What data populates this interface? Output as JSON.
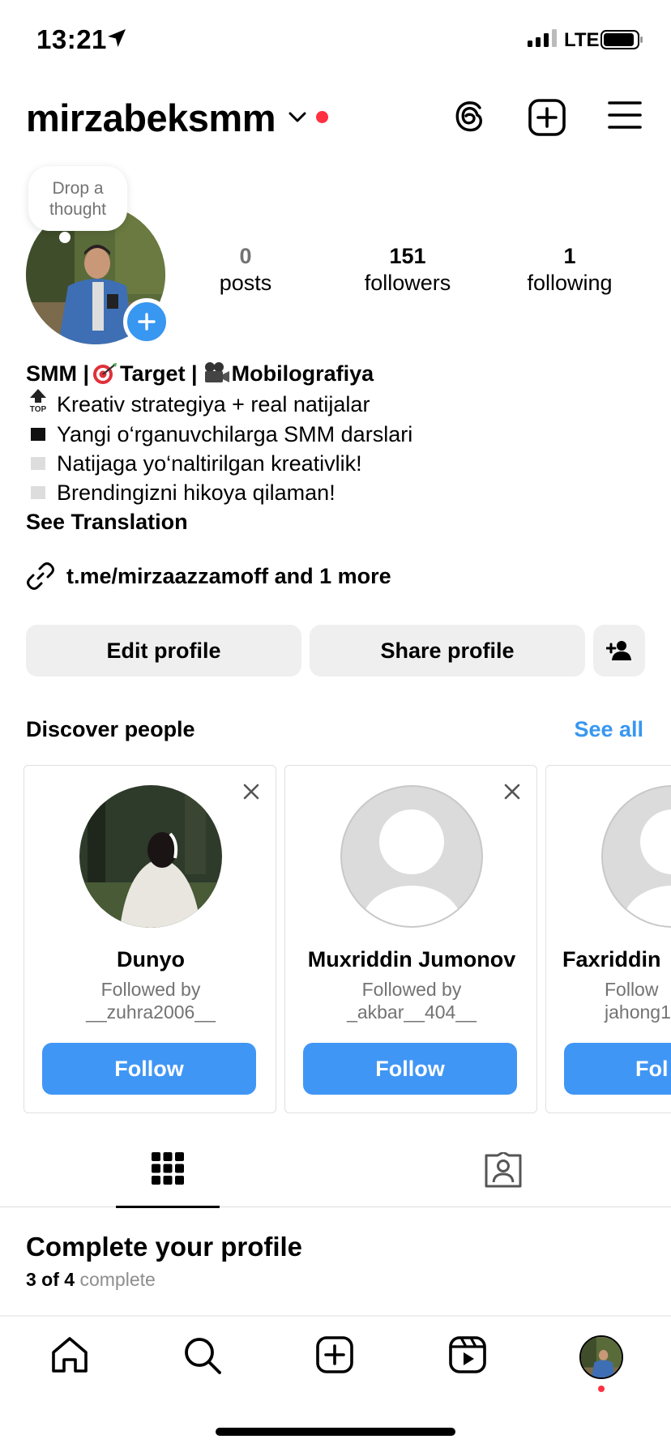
{
  "status_bar": {
    "time": "13:21",
    "network": "LTE"
  },
  "header": {
    "username": "mirzabeksmm",
    "icons": [
      "chevron-down-icon",
      "threads-icon",
      "create-post-icon",
      "menu-icon"
    ]
  },
  "note_bubble": {
    "line1": "Drop a",
    "line2": "thought"
  },
  "stats": {
    "posts": {
      "num": "0",
      "label": "posts"
    },
    "followers": {
      "num": "151",
      "label": "followers"
    },
    "following": {
      "num": "1",
      "label": "following"
    }
  },
  "bio": {
    "name_a": "SMM | ",
    "name_b": " Target | ",
    "name_c": " Mobilografiya",
    "line1": "Kreativ strategiya + real natijalar",
    "line2": "Yangi o‘rganuvchilarga SMM darslari",
    "line3": "Natijaga yo‘naltirilgan kreativlik!",
    "line4": "Brendingizni hikoya qilaman!",
    "see_translation": "See Translation",
    "top_badge": "TOP"
  },
  "link": {
    "text": "t.me/mirzaazzamoff and 1 more"
  },
  "actions": {
    "edit": "Edit profile",
    "share": "Share profile"
  },
  "discover": {
    "title": "Discover people",
    "see_all": "See all",
    "cards": [
      {
        "name": "Dunyo",
        "followed_by": "Followed by",
        "follower": "__zuhra2006__",
        "button": "Follow"
      },
      {
        "name": "Muxriddin Jumonov",
        "followed_by": "Followed by",
        "follower": "_akbar__404__",
        "button": "Follow"
      },
      {
        "name": "Faxriddin",
        "followed_by": "Follow",
        "follower": "jahong1",
        "button": "Fol"
      }
    ]
  },
  "complete": {
    "title": "Complete your profile",
    "count": "3 of 4",
    "label": "complete"
  },
  "colors": {
    "accent": "#3897f0",
    "follow_button": "#4096f5",
    "button_bg": "#efefef",
    "notification": "#ff3040",
    "secondary_text": "#737373"
  }
}
